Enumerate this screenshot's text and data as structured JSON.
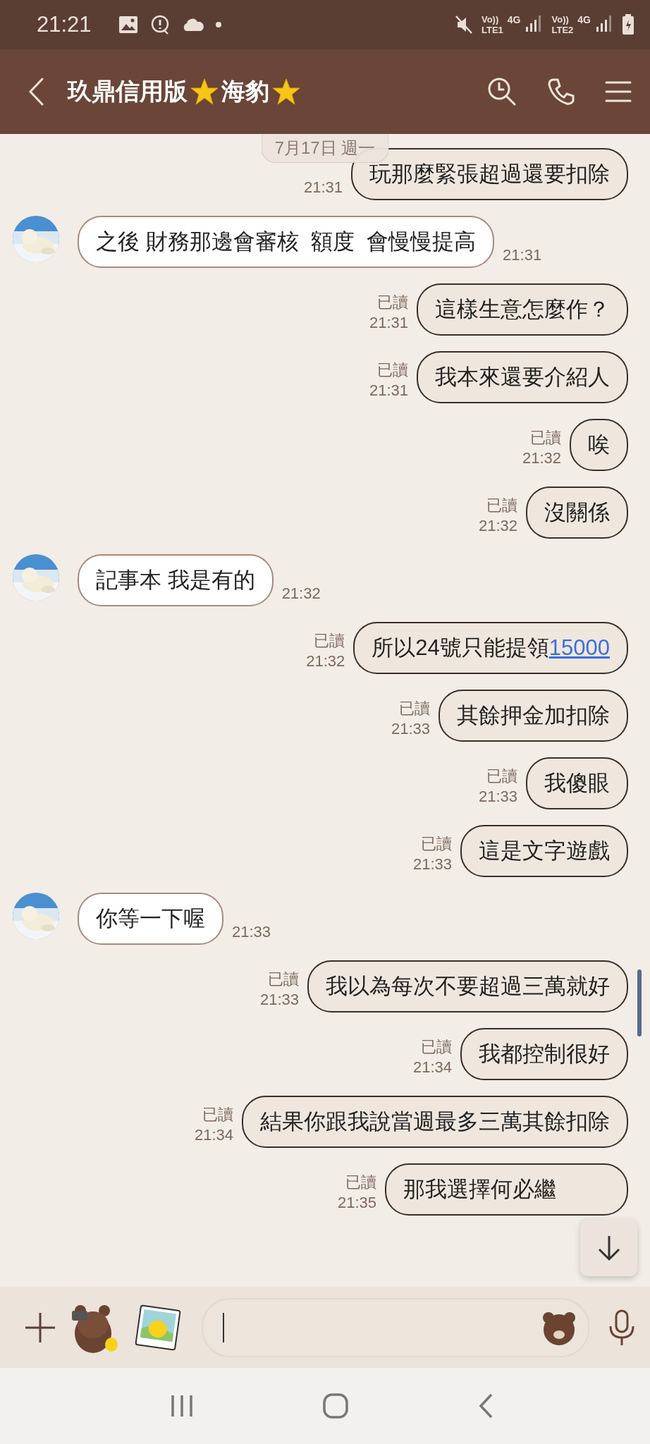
{
  "status_bar": {
    "time": "21:21",
    "sims": [
      {
        "volte": "Vo))",
        "network": "LTE1",
        "generation": "4G"
      },
      {
        "volte": "Vo))",
        "network": "LTE2",
        "generation": "4G"
      }
    ]
  },
  "header": {
    "title_parts": [
      "玖鼎信用版",
      "海豹"
    ]
  },
  "date_chip": "7月17日 週一",
  "messages": [
    {
      "kind": "outgoing",
      "text": "玩那麼緊張超過還要扣除",
      "time": "21:31"
    },
    {
      "kind": "incoming",
      "text": "之後 財務那邊會審核  額度  會慢慢提高",
      "time": "21:31"
    },
    {
      "kind": "outgoing",
      "text": "這樣生意怎麼作？",
      "read": "已讀",
      "time": "21:31"
    },
    {
      "kind": "outgoing",
      "text": "我本來還要介紹人",
      "read": "已讀",
      "time": "21:31"
    },
    {
      "kind": "outgoing",
      "text": "唉",
      "read": "已讀",
      "time": "21:32"
    },
    {
      "kind": "outgoing",
      "text": "沒關係",
      "read": "已讀",
      "time": "21:32"
    },
    {
      "kind": "incoming",
      "text": "記事本 我是有的",
      "time": "21:32"
    },
    {
      "kind": "outgoing",
      "text": "所以24號只能提領",
      "link": "15000",
      "read": "已讀",
      "time": "21:32"
    },
    {
      "kind": "outgoing",
      "text": "其餘押金加扣除",
      "read": "已讀",
      "time": "21:33"
    },
    {
      "kind": "outgoing",
      "text": "我傻眼",
      "read": "已讀",
      "time": "21:33"
    },
    {
      "kind": "outgoing",
      "text": "這是文字遊戲",
      "read": "已讀",
      "time": "21:33"
    },
    {
      "kind": "incoming",
      "text": "你等一下喔",
      "time": "21:33"
    },
    {
      "kind": "outgoing",
      "text": "我以為每次不要超過三萬就好",
      "read": "已讀",
      "time": "21:33"
    },
    {
      "kind": "outgoing",
      "text": "我都控制很好",
      "read": "已讀",
      "time": "21:34"
    },
    {
      "kind": "outgoing",
      "text": "結果你跟我說當週最多三萬其餘扣除",
      "read": "已讀",
      "time": "21:34"
    },
    {
      "kind": "outgoing",
      "text": "那我選擇何必繼",
      "read": "已讀",
      "time": "21:35"
    }
  ]
}
